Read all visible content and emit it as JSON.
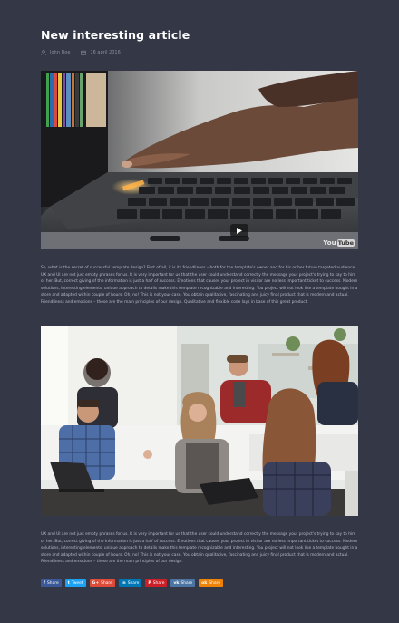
{
  "article": {
    "title": "New interesting article",
    "author": "John Doe",
    "date": "16 april 2016"
  },
  "video": {
    "watermark_you": "You",
    "watermark_tube": "Tube",
    "play_icon": "play-icon"
  },
  "paragraphs": {
    "first": "So, what is the secret of successful template design? First of all, it is its friendliness – both for the template's owner and for his or her future targeted audience. UX and UI are not just empty phrases for us. It is very important for us that the user could understand correctly the message your project's trying to say to him or her. But, correct giving of the information is just a half of success. Emotions that causes your project in visitor are no less important ticket to success. Modern solutions, interesting elements, unique approach to details make this template recognizable and interesting. You project will not look like a template bought in a store and adapted within couple of hours. Oh, no! This is not your case. You obtain qualitative, fascinating and juicy final product that is modern and actual. Friendliness and emotions – these are the main principles of our design. Qualitative and flexible code lays in base of this great product.",
    "second": "UX and UI are not just empty phrases for us. It is very important for us that the user could understand correctly the message your project's trying to say to him or her. But, correct giving of the information is just a half of success. Emotions that causes your project in visitor are no less important ticket to success. Modern solutions, interesting elements, unique approach to details make this template recognizable and interesting. You project will not look like a template bought in a store and adapted within couple of hours. Oh, no! This is not your case. You obtain qualitative, fascinating and juicy final product that is modern and actual. Friendliness and emotions – these are the main principles of our design."
  },
  "share_buttons": [
    {
      "glyph": "f",
      "label": "Share",
      "color": "#3b5998",
      "icon": "facebook-icon"
    },
    {
      "glyph": "t",
      "label": "Tweet",
      "color": "#1da1f2",
      "icon": "twitter-icon"
    },
    {
      "glyph": "G+",
      "label": "Share",
      "color": "#dd4b39",
      "icon": "google-plus-icon"
    },
    {
      "glyph": "in",
      "label": "Share",
      "color": "#0077b5",
      "icon": "linkedin-icon"
    },
    {
      "glyph": "P",
      "label": "Share",
      "color": "#cb2027",
      "icon": "pinterest-icon"
    },
    {
      "glyph": "vk",
      "label": "Share",
      "color": "#4c75a3",
      "icon": "vk-icon"
    },
    {
      "glyph": "ok",
      "label": "Share",
      "color": "#ee8208",
      "icon": "odnoklassniki-icon"
    }
  ],
  "colors": {
    "background": "#333746",
    "title": "#ffffff",
    "body_text": "#b7bbc8",
    "meta_text": "#8a8ea0"
  }
}
